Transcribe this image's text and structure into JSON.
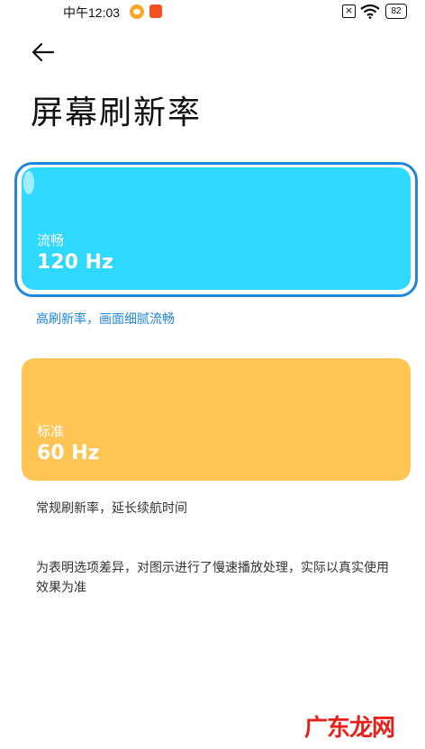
{
  "status_bar": {
    "time": "中午12:03",
    "battery": "82",
    "icons": [
      "weibo-icon",
      "message-icon",
      "close-box-icon",
      "wifi-icon",
      "battery-icon"
    ]
  },
  "header": {
    "back_icon": "arrow-left-icon",
    "title": "屏幕刷新率"
  },
  "options": [
    {
      "name": "流畅",
      "rate": "120 Hz",
      "caption": "高刷新率，画面细腻流畅",
      "color": "#2fd8fd",
      "selected": true
    },
    {
      "name": "标准",
      "rate": "60 Hz",
      "caption": "常规刷新率，延长续航时间",
      "color": "#fec555",
      "selected": false
    }
  ],
  "note": "为表明选项差异，对图示进行了慢速播放处理，实际以真实使用效果为准",
  "watermark": "广东龙网",
  "colors": {
    "accent": "#1f86d8",
    "card_120": "#2fd8fd",
    "card_60": "#fec555"
  }
}
